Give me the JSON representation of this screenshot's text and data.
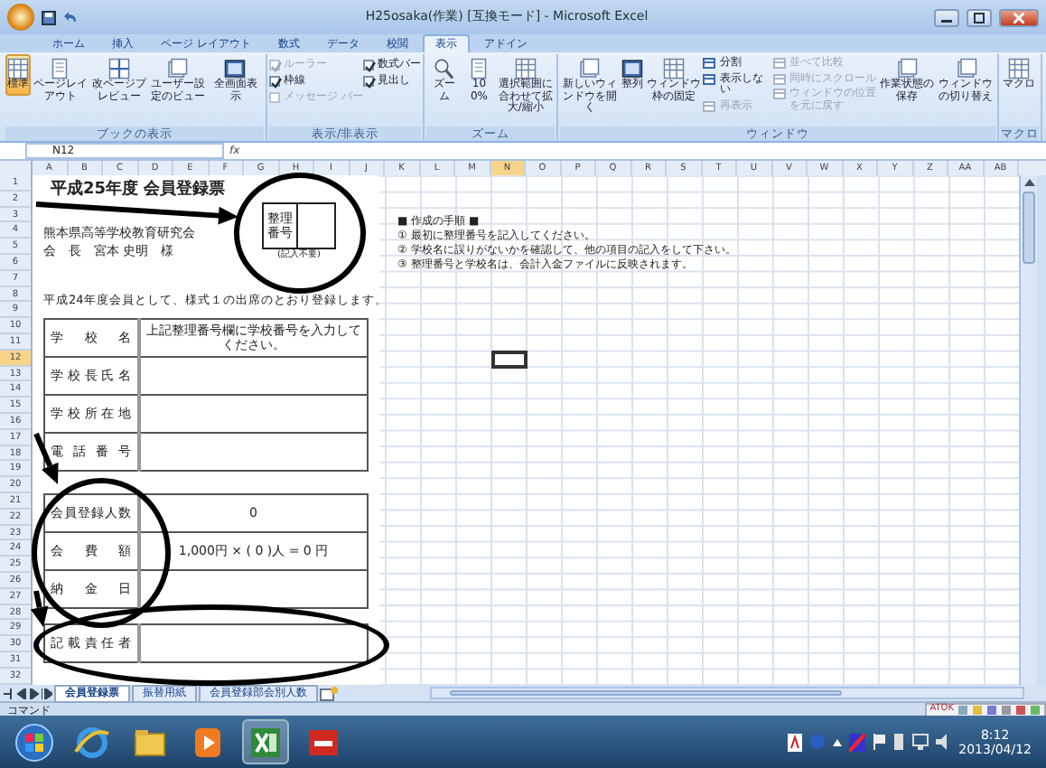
{
  "window": {
    "title": "H25osaka(作業) [互換モード] - Microsoft Excel"
  },
  "ribbon_tabs": [
    {
      "label": "ホーム",
      "selected": false
    },
    {
      "label": "挿入",
      "selected": false
    },
    {
      "label": "ページ レイアウト",
      "selected": false
    },
    {
      "label": "数式",
      "selected": false
    },
    {
      "label": "データ",
      "selected": false
    },
    {
      "label": "校閲",
      "selected": false
    },
    {
      "label": "表示",
      "selected": true
    },
    {
      "label": "アドイン",
      "selected": false
    }
  ],
  "ribbon_groups": [
    {
      "label": "ブックの表示",
      "items": [
        {
          "kind": "big",
          "label": "標準",
          "selected": true
        },
        {
          "kind": "big",
          "label": "ページレイアウト",
          "selected": false
        },
        {
          "kind": "big",
          "label": "改ページプレビュー",
          "selected": false
        },
        {
          "kind": "big",
          "label": "ユーザー設定のビュー",
          "selected": false
        },
        {
          "kind": "big",
          "label": "全画面表示",
          "selected": false
        }
      ]
    },
    {
      "label": "表示/非表示",
      "items": [
        {
          "kind": "check",
          "label": "ルーラー",
          "checked": true,
          "disabled": true
        },
        {
          "kind": "check",
          "label": "枠線",
          "checked": true,
          "disabled": false
        },
        {
          "kind": "check",
          "label": "メッセージ バー",
          "checked": false,
          "disabled": true
        },
        {
          "kind": "check",
          "label": "数式バー",
          "checked": true,
          "disabled": false
        },
        {
          "kind": "check",
          "label": "見出し",
          "checked": true,
          "disabled": false
        }
      ]
    },
    {
      "label": "ズーム",
      "items": [
        {
          "kind": "big",
          "label": "ズーム",
          "selected": false
        },
        {
          "kind": "big",
          "label": "100%",
          "selected": false
        },
        {
          "kind": "big",
          "label": "選択範囲に合わせて拡大/縮小",
          "selected": false
        }
      ]
    },
    {
      "label": "ウィンドウ",
      "items": [
        {
          "kind": "big",
          "label": "新しいウィンドウを開く",
          "selected": false
        },
        {
          "kind": "big",
          "label": "整列",
          "selected": false
        },
        {
          "kind": "big",
          "label": "ウィンドウ枠の固定",
          "selected": false
        },
        {
          "kind": "small",
          "label": "分割",
          "disabled": false
        },
        {
          "kind": "small",
          "label": "表示しない",
          "disabled": false
        },
        {
          "kind": "small",
          "label": "再表示",
          "disabled": true
        },
        {
          "kind": "small",
          "label": "並べて比較",
          "disabled": true
        },
        {
          "kind": "small",
          "label": "同時にスクロール",
          "disabled": true
        },
        {
          "kind": "small",
          "label": "ウィンドウの位置を元に戻す",
          "disabled": true
        },
        {
          "kind": "big",
          "label": "作業状態の保存",
          "selected": false
        },
        {
          "kind": "big",
          "label": "ウィンドウの切り替え",
          "selected": false
        }
      ]
    },
    {
      "label": "マクロ",
      "items": [
        {
          "kind": "big",
          "label": "マクロ",
          "selected": false
        }
      ]
    }
  ],
  "formula_bar": {
    "name_box": "N12",
    "function_label": "fx"
  },
  "columns": [
    {
      "label": "A",
      "selected": false
    },
    {
      "label": "B",
      "selected": false
    },
    {
      "label": "C",
      "selected": false
    },
    {
      "label": "D",
      "selected": false
    },
    {
      "label": "E",
      "selected": false
    },
    {
      "label": "F",
      "selected": false
    },
    {
      "label": "G",
      "selected": false
    },
    {
      "label": "H",
      "selected": false
    },
    {
      "label": "I",
      "selected": false
    },
    {
      "label": "J",
      "selected": false
    },
    {
      "label": "K",
      "selected": false
    },
    {
      "label": "L",
      "selected": false
    },
    {
      "label": "M",
      "selected": false
    },
    {
      "label": "N",
      "selected": true
    },
    {
      "label": "O",
      "selected": false
    },
    {
      "label": "P",
      "selected": false
    },
    {
      "label": "Q",
      "selected": false
    },
    {
      "label": "R",
      "selected": false
    },
    {
      "label": "S",
      "selected": false
    },
    {
      "label": "T",
      "selected": false
    },
    {
      "label": "U",
      "selected": false
    },
    {
      "label": "V",
      "selected": false
    },
    {
      "label": "W",
      "selected": false
    },
    {
      "label": "X",
      "selected": false
    },
    {
      "label": "Y",
      "selected": false
    },
    {
      "label": "Z",
      "selected": false
    },
    {
      "label": "AA",
      "selected": false
    },
    {
      "label": "AB",
      "selected": false
    }
  ],
  "rows": [
    {
      "label": "1",
      "selected": false
    },
    {
      "label": "2",
      "selected": false
    },
    {
      "label": "3",
      "selected": false
    },
    {
      "label": "4",
      "selected": false
    },
    {
      "label": "5",
      "selected": false
    },
    {
      "label": "6",
      "selected": false
    },
    {
      "label": "7",
      "selected": false
    },
    {
      "label": "8",
      "selected": false
    },
    {
      "label": "9",
      "selected": false
    },
    {
      "label": "10",
      "selected": false
    },
    {
      "label": "11",
      "selected": false
    },
    {
      "label": "12",
      "selected": true
    },
    {
      "label": "13",
      "selected": false
    },
    {
      "label": "14",
      "selected": false
    },
    {
      "label": "15",
      "selected": false
    },
    {
      "label": "16",
      "selected": false
    },
    {
      "label": "17",
      "selected": false
    },
    {
      "label": "18",
      "selected": false
    },
    {
      "label": "19",
      "selected": false
    },
    {
      "label": "20",
      "selected": false
    },
    {
      "label": "21",
      "selected": false
    },
    {
      "label": "22",
      "selected": false
    },
    {
      "label": "23",
      "selected": false
    },
    {
      "label": "24",
      "selected": false
    },
    {
      "label": "25",
      "selected": false
    },
    {
      "label": "26",
      "selected": false
    },
    {
      "label": "27",
      "selected": false
    },
    {
      "label": "28",
      "selected": false
    },
    {
      "label": "29",
      "selected": false
    },
    {
      "label": "30",
      "selected": false
    },
    {
      "label": "31",
      "selected": false
    },
    {
      "label": "32",
      "selected": false
    }
  ],
  "form": {
    "title": "平成25年度 会員登録票",
    "number_box": {
      "label": "整理番号",
      "note": "(記入不要)"
    },
    "organization": "熊本県高等学校教育研究会",
    "addressee": "会　長　宮本 史明　様",
    "statement": "平成24年度会員として、様式１の出席のとおり登録します。",
    "tables": [
      [
        {
          "label": "学校名",
          "value": "上記整理番号欄に学校番号を入力してください。"
        },
        {
          "label": "学校長氏名"
        },
        {
          "label": "学校所在地"
        },
        {
          "label": "電話番号"
        }
      ],
      [
        {
          "label": "会員登録人数",
          "value": "0"
        },
        {
          "label": "会費額",
          "value": "1,000円 × ( 0 )人 = 0 円"
        },
        {
          "label": "納金日"
        }
      ],
      [
        {
          "label": "記載責任者"
        }
      ]
    ]
  },
  "notes": [
    "■ 作成の手順 ■",
    "① 最初に整理番号を記入してください。",
    "② 学校名に誤りがないかを確認して、他の項目の記入をして下さい。",
    "③ 整理番号と学校名は、会計入金ファイルに反映されます。"
  ],
  "sheet_tabs": [
    {
      "label": "会員登録票",
      "selected": true
    },
    {
      "label": "振替用紙",
      "selected": false
    },
    {
      "label": "会員登録部会別人数",
      "selected": false
    }
  ],
  "status_bar": {
    "mode": "コマンド"
  },
  "ime_bar": {
    "label": "ATOK"
  },
  "clock": {
    "time": "8:12",
    "date": "2013/04/12"
  }
}
